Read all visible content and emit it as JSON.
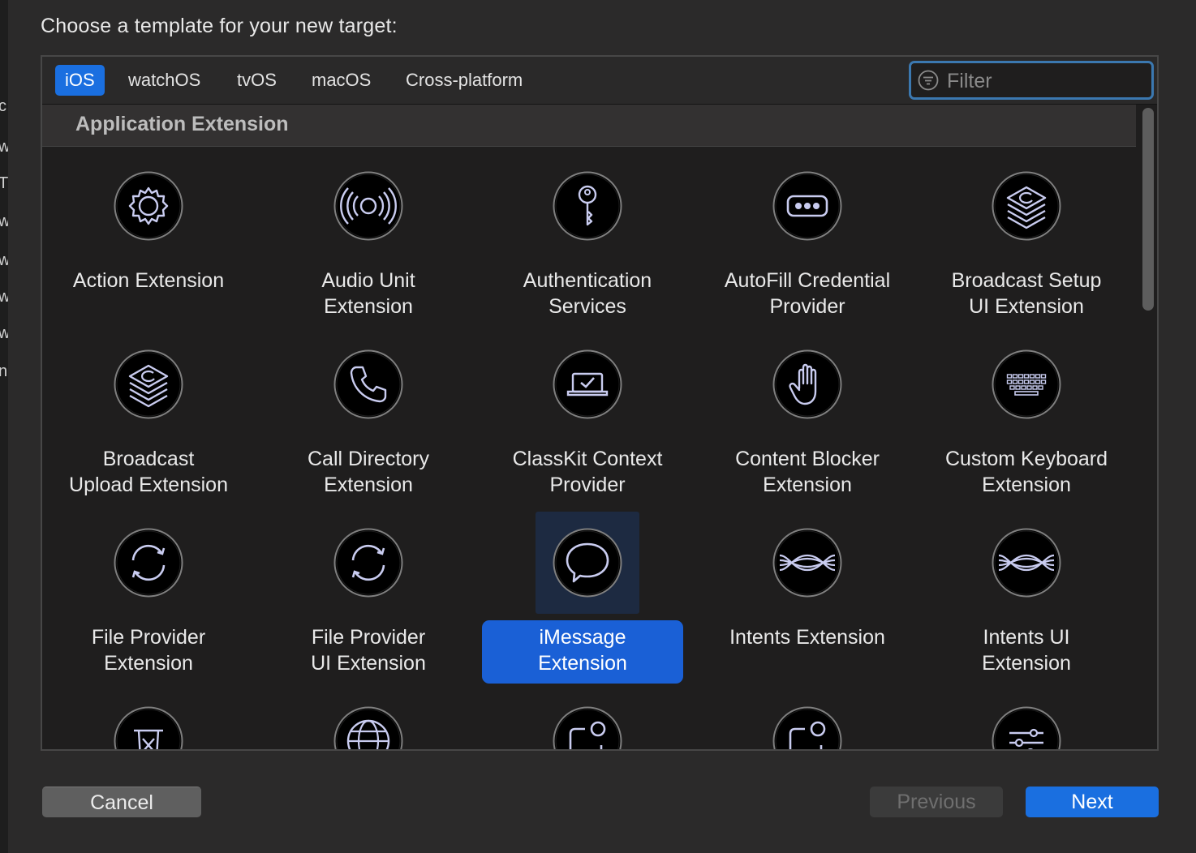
{
  "sheet": {
    "title": "Choose a template for your new target:"
  },
  "platform_tabs": [
    {
      "label": "iOS",
      "selected": true
    },
    {
      "label": "watchOS",
      "selected": false
    },
    {
      "label": "tvOS",
      "selected": false
    },
    {
      "label": "macOS",
      "selected": false
    },
    {
      "label": "Cross-platform",
      "selected": false
    }
  ],
  "filter": {
    "placeholder": "Filter",
    "value": ""
  },
  "section": {
    "title": "Application Extension"
  },
  "templates": [
    {
      "label": "Action Extension",
      "icon": "gear-icon"
    },
    {
      "label": "Audio Unit\nExtension",
      "icon": "audio-waves-icon"
    },
    {
      "label": "Authentication\nServices",
      "icon": "key-icon"
    },
    {
      "label": "AutoFill Credential\nProvider",
      "icon": "password-dots-icon"
    },
    {
      "label": "Broadcast Setup\nUI Extension",
      "icon": "broadcast-stack-icon"
    },
    {
      "label": "Broadcast\nUpload Extension",
      "icon": "broadcast-stack-icon"
    },
    {
      "label": "Call Directory\nExtension",
      "icon": "phone-icon"
    },
    {
      "label": "ClassKit Context\nProvider",
      "icon": "classkit-laptop-icon"
    },
    {
      "label": "Content Blocker\nExtension",
      "icon": "hand-icon"
    },
    {
      "label": "Custom Keyboard\nExtension",
      "icon": "keyboard-icon"
    },
    {
      "label": "File Provider\nExtension",
      "icon": "sync-arrows-icon"
    },
    {
      "label": "File Provider\nUI Extension",
      "icon": "sync-arrows-icon"
    },
    {
      "label": "iMessage\nExtension",
      "icon": "message-bubble-icon",
      "selected": true
    },
    {
      "label": "Intents Extension",
      "icon": "intents-waves-icon"
    },
    {
      "label": "Intents UI\nExtension",
      "icon": "intents-waves-icon"
    },
    {
      "label": "",
      "icon": "trash-icon"
    },
    {
      "label": "",
      "icon": "globe-icon"
    },
    {
      "label": "",
      "icon": "notification-icon"
    },
    {
      "label": "",
      "icon": "notification-icon"
    },
    {
      "label": "",
      "icon": "sliders-icon"
    }
  ],
  "buttons": {
    "cancel": "Cancel",
    "previous": "Previous",
    "next": "Next"
  },
  "colors": {
    "accent": "#1a6fe0",
    "selection_label": "#1a60d6",
    "icon_stroke": "#c9ccf0"
  }
}
